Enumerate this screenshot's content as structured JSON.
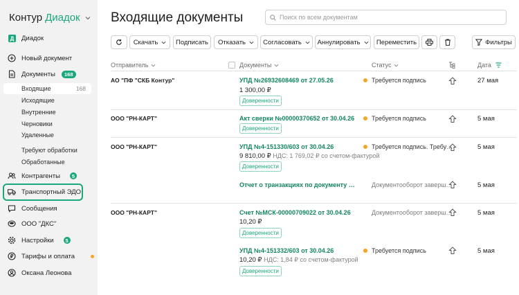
{
  "brand": {
    "name": "Контур",
    "product": "Диадок"
  },
  "sidebar": {
    "org_top": "Диадок",
    "new_doc": "Новый документ",
    "documents": {
      "label": "Документы",
      "badge": "168"
    },
    "subs": {
      "incoming": {
        "label": "Входящие",
        "count": "168"
      },
      "outgoing": "Исходящие",
      "internal": "Внутренние",
      "drafts": "Черновики",
      "deleted": "Удаленные",
      "need_processing": "Требуют обработки",
      "processed": "Обработанные"
    },
    "contractors": {
      "label": "Контрагенты",
      "badge": "5"
    },
    "transport": "Транспортный ЭДО",
    "messages": "Сообщения",
    "org": "ООО \"ДКС\"",
    "settings": {
      "label": "Настройки",
      "badge": "5"
    },
    "tariffs": "Тарифы и оплата",
    "user": "Оксана Леонова"
  },
  "header": {
    "title": "Входящие документы",
    "search_placeholder": "Поиск по всем документам"
  },
  "toolbar": {
    "download": "Скачать",
    "sign": "Подписать",
    "refuse": "Отказать",
    "approve": "Согласовать",
    "annul": "Аннулировать",
    "move": "Переместить",
    "filters": "Фильтры"
  },
  "columns": {
    "sender": "Отправитель",
    "documents": "Документы",
    "status": "Статус",
    "date": "Дата"
  },
  "rows": [
    {
      "sender": "АО \"ПФ \"СКБ Контур\"",
      "doc": "УПД №26932608469 от 27.05.26",
      "amount": "1 300,00 ₽",
      "vat": "",
      "tag": "Доверенности",
      "status": "Требуется подпись",
      "date": "27 мая"
    },
    {
      "sender": "ООО \"РН-КАРТ\"",
      "doc": "Акт сверки №00000370652 от 30.04.26",
      "amount": "",
      "vat": "",
      "tag": "Доверенности",
      "status": "Требуется подпись",
      "date": "5 мая"
    },
    {
      "sender": "ООО \"РН-КАРТ\"",
      "doc": "УПД №4-151330/603 от 30.04.26",
      "amount": "9 810,00 ₽",
      "vat": "НДС: 1 769,02 ₽ со счетом-фактурой",
      "tag": "Доверенности",
      "status": "Требуется подпись. Требу…",
      "date": "5 мая"
    },
    {
      "sender": "",
      "doc": "Отчет о транзакциях по документу …",
      "amount": "",
      "vat": "",
      "tag": "",
      "status": "Документооборот заверш…",
      "date": "5 мая"
    },
    {
      "sender": "ООО \"РН-КАРТ\"",
      "doc": "Счет №МСК-00000709022 от 30.04.26",
      "amount": "10,20 ₽",
      "vat": "",
      "tag": "Доверенности",
      "status": "Документооборот заверш…",
      "date": "5 мая"
    },
    {
      "sender": "",
      "doc": "УПД №4-151332/603 от 30.04.26",
      "amount": "10,20 ₽",
      "vat": "НДС: 1,84 ₽ со счетом-фактурой",
      "tag": "Доверенности",
      "status": "Требуется подпись",
      "date": "5 мая"
    }
  ],
  "colors": {
    "accent": "#1ba77e",
    "link": "#138561",
    "warning": "#f5a623"
  }
}
